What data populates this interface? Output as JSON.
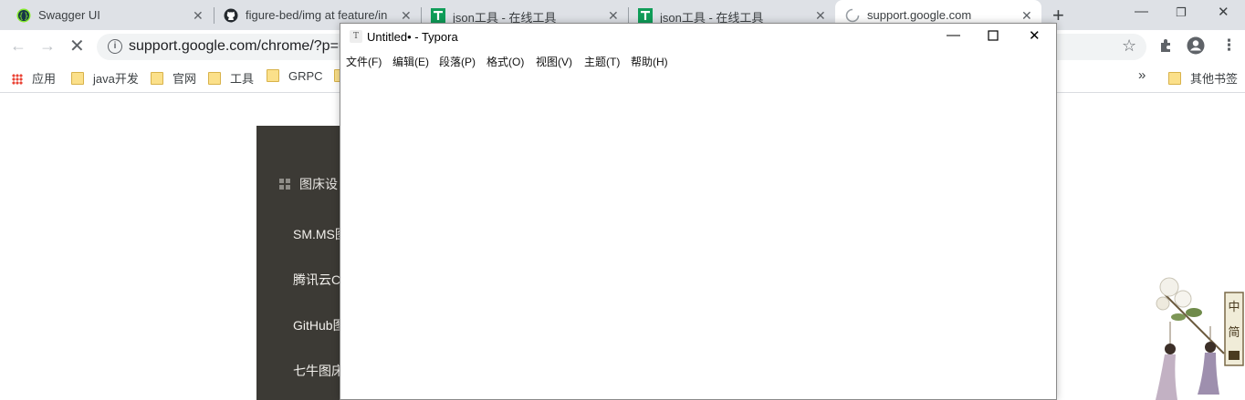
{
  "browser": {
    "tabs": [
      {
        "title": "Swagger UI",
        "icon": "swagger-icon",
        "active": false
      },
      {
        "title": "figure-bed/img at feature/in",
        "icon": "github-icon",
        "active": false
      },
      {
        "title": "json工具 - 在线工具",
        "icon": "t-green-icon",
        "active": false
      },
      {
        "title": "json工具 - 在线工具",
        "icon": "t-green-icon",
        "active": false
      },
      {
        "title": "support.google.com",
        "icon": "loading-spinner-icon",
        "active": true
      }
    ],
    "new_tab": "+",
    "url": "support.google.com/chrome/?p=u",
    "bookmarks": [
      {
        "label": "应用",
        "icon": "apps-grid-icon"
      },
      {
        "label": "java开发",
        "icon": "folder-icon"
      },
      {
        "label": "官网",
        "icon": "folder-icon"
      },
      {
        "label": "工具",
        "icon": "folder-icon"
      },
      {
        "label": "GRPC",
        "icon": "folder-icon"
      }
    ],
    "bookmarks_overflow": "»",
    "other_bookmarks": "其他书签"
  },
  "page": {
    "sidebar_heading": "图床设",
    "sidebar_items": [
      "SM.MS图",
      "腾讯云C",
      "GitHub图",
      "七牛图床"
    ]
  },
  "typora": {
    "title": "Untitled• - Typora",
    "app_icon_letter": "T",
    "menus": [
      "文件(F)",
      "编辑(E)",
      "段落(P)",
      "格式(O)",
      "视图(V)",
      "主题(T)",
      "帮助(H)"
    ]
  },
  "colors": {
    "tabstrip": "#dee1e6",
    "dark_panel": "#3c3a35",
    "tab_icon_green": "#0f9d58"
  }
}
